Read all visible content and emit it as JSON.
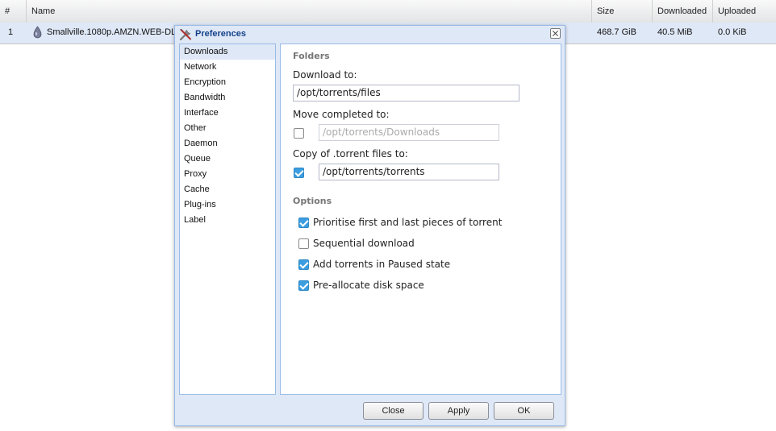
{
  "grid": {
    "columns": {
      "index": "#",
      "name": "Name",
      "size": "Size",
      "downloaded": "Downloaded",
      "uploaded": "Uploaded"
    },
    "rows": [
      {
        "index": "1",
        "name": "Smallville.1080p.AMZN.WEB-DL",
        "size": "468.7 GiB",
        "downloaded": "40.5 MiB",
        "uploaded": "0.0 KiB"
      }
    ]
  },
  "dialog": {
    "title": "Preferences",
    "nav": [
      "Downloads",
      "Network",
      "Encryption",
      "Bandwidth",
      "Interface",
      "Other",
      "Daemon",
      "Queue",
      "Proxy",
      "Cache",
      "Plug-ins",
      "Label"
    ],
    "selected_nav": "Downloads",
    "folders": {
      "legend": "Folders",
      "download_to_label": "Download to:",
      "download_to_value": "/opt/torrents/files",
      "move_completed_label": "Move completed to:",
      "move_completed_checked": false,
      "move_completed_value": "/opt/torrents/Downloads",
      "copy_torrent_label": "Copy of .torrent files to:",
      "copy_torrent_checked": true,
      "copy_torrent_value": "/opt/torrents/torrents"
    },
    "options": {
      "legend": "Options",
      "items": [
        {
          "label": "Prioritise first and last pieces of torrent",
          "checked": true
        },
        {
          "label": "Sequential download",
          "checked": false
        },
        {
          "label": "Add torrents in Paused state",
          "checked": true
        },
        {
          "label": "Pre-allocate disk space",
          "checked": true
        }
      ]
    },
    "buttons": {
      "close": "Close",
      "apply": "Apply",
      "ok": "OK"
    }
  },
  "colors": {
    "accent": "#3c9ee0",
    "selection": "#dfe8f6",
    "border": "#99bbe8"
  },
  "icons": {
    "torrent_state": "drop-icon",
    "dialog": "tools-icon",
    "close": "close-icon"
  }
}
